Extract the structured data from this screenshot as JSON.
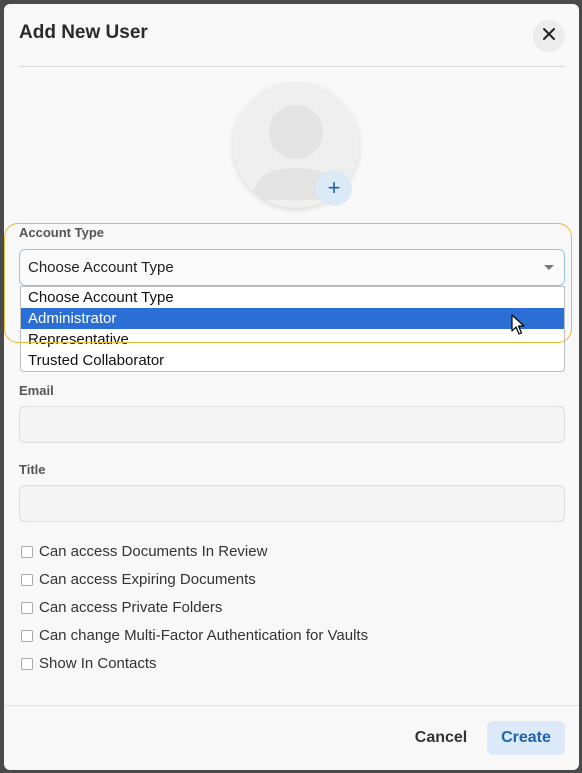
{
  "modal": {
    "title": "Add New User"
  },
  "icons": {
    "close": "close-icon",
    "avatar": "user-placeholder-icon",
    "avatar_add": "plus-icon",
    "select_caret": "chevron-down-icon",
    "cursor": "mouse-pointer-icon"
  },
  "avatar": {
    "add_label": "+"
  },
  "account_type": {
    "label": "Account Type",
    "selected_value": "Choose Account Type",
    "options": [
      {
        "label": "Choose Account Type",
        "selected": false
      },
      {
        "label": "Administrator",
        "selected": true
      },
      {
        "label": "Representative",
        "selected": false
      },
      {
        "label": "Trusted Collaborator",
        "selected": false
      }
    ]
  },
  "email": {
    "label": "Email",
    "value": "",
    "placeholder": ""
  },
  "title_field": {
    "label": "Title",
    "value": "",
    "placeholder": ""
  },
  "checkboxes": [
    {
      "label": "Can access Documents In Review",
      "checked": false
    },
    {
      "label": "Can access Expiring Documents",
      "checked": false
    },
    {
      "label": "Can access Private Folders",
      "checked": false
    },
    {
      "label": "Can change Multi-Factor Authentication for Vaults",
      "checked": false
    },
    {
      "label": "Show In Contacts",
      "checked": false
    }
  ],
  "footer": {
    "cancel_label": "Cancel",
    "create_label": "Create"
  },
  "colors": {
    "accent": "#2b6fd6",
    "highlight_ring": "#e8b93a",
    "create_bg": "#dbe9f8",
    "create_text": "#1f63ad"
  }
}
